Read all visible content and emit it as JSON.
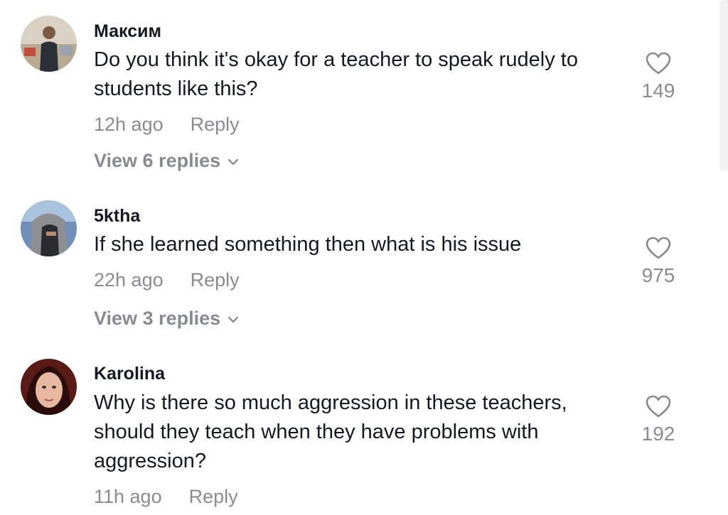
{
  "comments": [
    {
      "username": "Максим",
      "text": "Do you think it's okay for a teacher to speak rudely to students like this?",
      "time": "12h ago",
      "reply_label": "Reply",
      "likes": "149",
      "view_replies": "View 6 replies",
      "avatar_icon": "person-photo"
    },
    {
      "username": "5ktha",
      "text": "If she learned something then what is his issue",
      "time": "22h ago",
      "reply_label": "Reply",
      "likes": "975",
      "view_replies": "View 3 replies",
      "avatar_icon": "hooded-person-photo"
    },
    {
      "username": "Karolina",
      "text": "Why is there so much aggression in these teachers, should they teach when they have problems with aggression?",
      "time": "11h ago",
      "reply_label": "Reply",
      "likes": "192",
      "avatar_icon": "woman-portrait-photo"
    }
  ],
  "colors": {
    "primary_text": "#161823",
    "secondary_text": "#8a8b91",
    "icon_stroke": "#8a8b91"
  }
}
